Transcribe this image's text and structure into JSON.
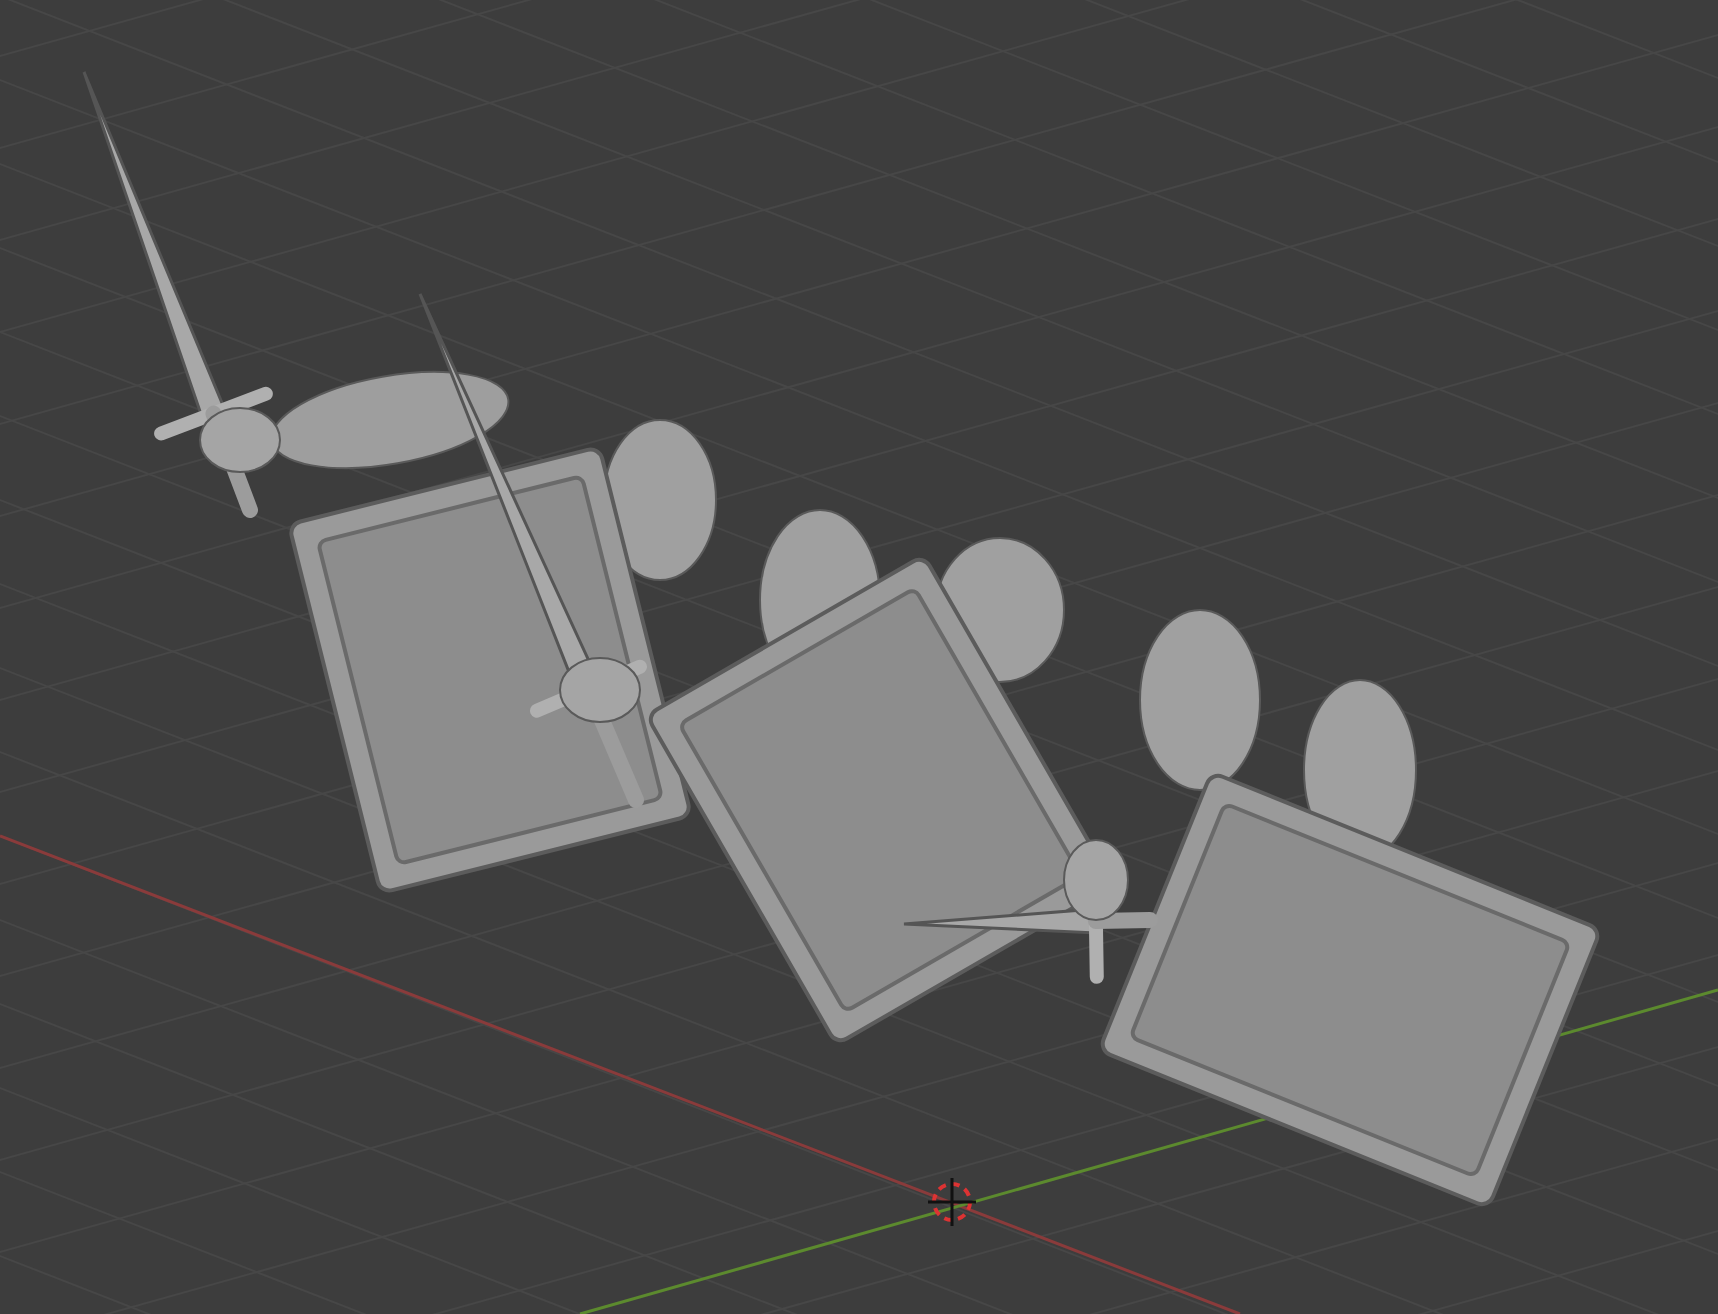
{
  "viewport": {
    "show_grid": true,
    "show_axes": true,
    "show_cursor": true
  }
}
